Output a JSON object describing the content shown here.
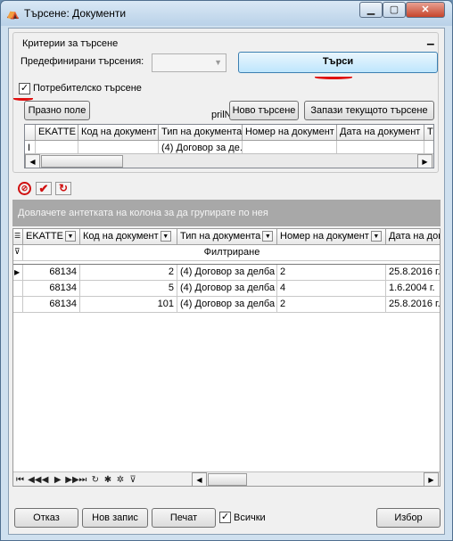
{
  "window": {
    "title": "Търсене: Документи",
    "icons": {
      "app": "app-icon",
      "minimize": "minimize-icon",
      "maximize": "maximize-icon",
      "close": "close-icon"
    }
  },
  "criteria": {
    "legend": "Критерии за търсене",
    "collapse_glyph": "▁",
    "predefined_label": "Предефинирани търсения:",
    "predefined_value": "",
    "search_button": "Търси",
    "user_search_label": "Потребителско търсене",
    "user_search_checked": true,
    "empty_field_button": "Празно поле",
    "prl_label": "prilN",
    "new_search_button": "Ново търсене",
    "save_search_button": "Запази текущото търсене",
    "grid": {
      "columns": [
        "EKATTE",
        "Код на документ",
        "Тип на документа",
        "Номер на документ",
        "Дата на документ",
        "Т"
      ],
      "row": [
        "",
        "",
        "(4) Договор за де.",
        "",
        "",
        ""
      ],
      "row_marker": "I"
    }
  },
  "toolbar_icons": [
    "cancel-filter-icon",
    "check-filter-icon",
    "refresh-filter-icon"
  ],
  "results": {
    "group_hint": "Довлачете антетката на колона за да групирате по нея",
    "columns": [
      "EKATTE",
      "Код на документ",
      "Тип на документа",
      "Номер на документ",
      "Дата на док"
    ],
    "filter_label": "Филтриране",
    "rows": [
      [
        "68134",
        "2",
        "(4) Договор за делба",
        "2",
        "25.8.2016 г."
      ],
      [
        "68134",
        "5",
        "(4) Договор за делба",
        "4",
        "1.6.2004 г."
      ],
      [
        "68134",
        "101",
        "(4) Договор за делба",
        "2",
        "25.8.2016 г."
      ]
    ],
    "nav_glyphs": [
      "⏮",
      "◀◀",
      "◀",
      "▶",
      "▶▶",
      "⏭",
      "↻",
      "✱",
      "✲",
      "⊽"
    ]
  },
  "footer": {
    "cancel_button": "Отказ",
    "new_record_button": "Нов запис",
    "print_button": "Печат",
    "all_label": "Всички",
    "all_checked": true,
    "select_button": "Избор"
  },
  "accent_colors": {
    "annotation": "#e01010",
    "header_band": "#a8a8a8"
  }
}
